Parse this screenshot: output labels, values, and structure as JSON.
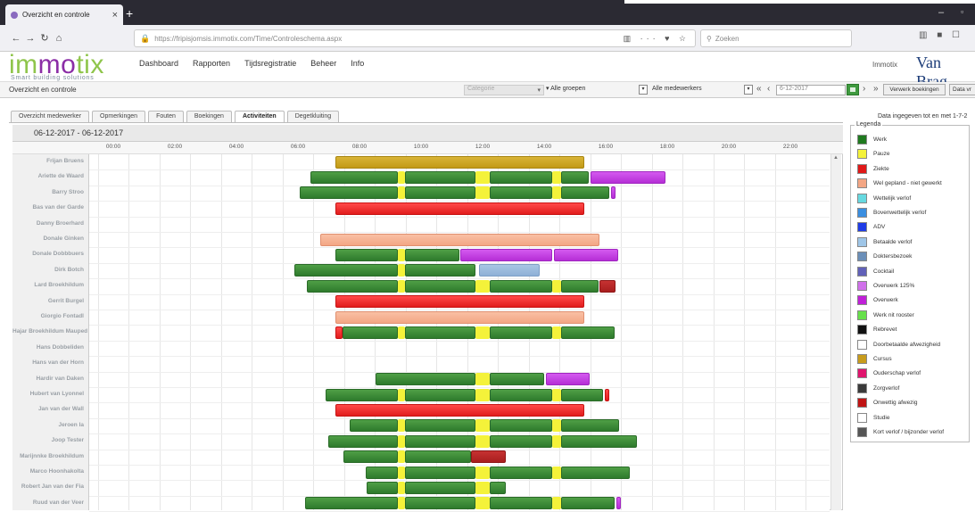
{
  "browser": {
    "tab_title": "Overzicht en controle",
    "tab_close": "×",
    "new_tab": "+",
    "url": "https://fripisjomsis.immotix.com/Time/Controleschema.aspx",
    "search_placeholder": "Zoeken",
    "url_tools": "▥ ··· ♥ ☆",
    "toolbar_icons": "▥ ■ ☐",
    "win_min": "–",
    "win_max": "▫"
  },
  "app": {
    "logo_main_1": "im",
    "logo_main_2": "mo",
    "logo_main_3": "tix",
    "logo_sub": "Smart building solutions",
    "nav": [
      "Dashboard",
      "Rapporten",
      "Tijdsregistratie",
      "Beheer",
      "Info"
    ],
    "user_name": "Immotix",
    "brand_right": "Van Brag"
  },
  "page": {
    "title": "Overzicht en controle",
    "filter_grey": "Categorie",
    "groups": "Alle groepen",
    "employees": "Alle medewerkers",
    "date_value": "6-12-2017",
    "btn_process": "Verwerk boekingen",
    "btn_date": "Data vr",
    "data_info": "Data ingegeven tot en met 1-7-2"
  },
  "tabs": [
    "Overzicht medewerker",
    "Opmerkingen",
    "Fouten",
    "Boekingen",
    "Activiteiten",
    "Degetkluiting"
  ],
  "active_tab": "Activiteiten",
  "gantt": {
    "date_range": "06-12-2017 - 06-12-2017",
    "hours": [
      "00:00",
      "02:00",
      "04:00",
      "06:00",
      "08:00",
      "10:00",
      "12:00",
      "14:00",
      "16:00",
      "18:00",
      "20:00",
      "22:00"
    ],
    "employees": [
      "Frijan Bruens",
      "Ariette de Waard",
      "Barry Stroo",
      "Bas van der Garde",
      "Danny Broerhard",
      "Donale Ginken",
      "Donale Dobbbuers",
      "Dirk Botch",
      "Lard Broekhildum",
      "Gerrit Burgel",
      "Giorgio Fontadl",
      "Hajar Broekhildum Mauped",
      "Hans Dobbeliden",
      "Hans van der Horn",
      "Hardir van Daken",
      "Hubert van Lyonnel",
      "Jan van der Wall",
      "Jeroen la",
      "Joop Tester",
      "Marijnnke Broekhildum",
      "Marco Hoonhakolta",
      "Robert Jan van der Fia",
      "Ruud van der Veer"
    ]
  },
  "legend": {
    "title": "Legenda",
    "items": [
      {
        "label": "Werk",
        "color": "#1f7a1f"
      },
      {
        "label": "Pauze",
        "color": "#f4f23a"
      },
      {
        "label": "Ziekte",
        "color": "#e01818"
      },
      {
        "label": "Wel gepland - niet gewerkt",
        "color": "#f3a684"
      },
      {
        "label": "Wettelijk verlof",
        "color": "#66d9e0"
      },
      {
        "label": "Bovenwettelijk verlof",
        "color": "#3a8ee0"
      },
      {
        "label": "ADV",
        "color": "#1f3ce6"
      },
      {
        "label": "Betaalde verlof",
        "color": "#9fc6e8"
      },
      {
        "label": "Doktersbezoek",
        "color": "#6b8fb8"
      },
      {
        "label": "Cocktail",
        "color": "#6161b8"
      },
      {
        "label": "Overwerk 125%",
        "color": "#d070ea"
      },
      {
        "label": "Overwerk",
        "color": "#c020d8"
      },
      {
        "label": "Werk nit rooster",
        "color": "#66e04a"
      },
      {
        "label": "Rebrevet",
        "color": "#111111"
      },
      {
        "label": "Doorbetaalde afwezigheid",
        "color": "#ffffff"
      },
      {
        "label": "Cursus",
        "color": "#c89c1c"
      },
      {
        "label": "Ouderschap verlof",
        "color": "#e0156e"
      },
      {
        "label": "Zorgverlof",
        "color": "#3a3a3a"
      },
      {
        "label": "Onwettig afwezig",
        "color": "#c01414"
      },
      {
        "label": "Studie",
        "color": "#ffffff"
      },
      {
        "label": "Kort verlof / bijzonder verlof",
        "color": "#555555"
      }
    ]
  }
}
